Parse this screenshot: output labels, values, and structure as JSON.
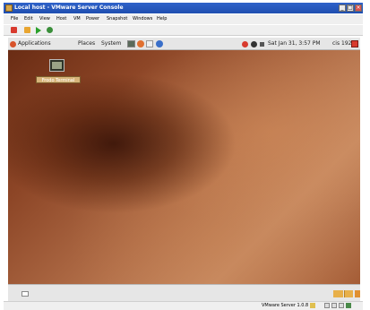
{
  "window": {
    "title": "Local host - VMware Server Console",
    "minimize_glyph": "_",
    "maximize_glyph": "□",
    "close_glyph": "×"
  },
  "menubar": {
    "items": [
      "File",
      "Edit",
      "View",
      "Host",
      "VM",
      "Power",
      "Snapshot",
      "Windows",
      "Help"
    ]
  },
  "guest_panel": {
    "applications": "Applications",
    "places": "Places",
    "system": "System",
    "clock": "Sat Jan 31,  3:57 PM",
    "user": "cis 192"
  },
  "desktop": {
    "icon_label": "Frodo Terminal"
  },
  "statusbar": {
    "text": "VMware Server 1.0.8"
  },
  "colors": {
    "titlebar": "#1f4fb0",
    "desktop_dark": "#6a2c14",
    "desktop_light": "#c88c64"
  }
}
